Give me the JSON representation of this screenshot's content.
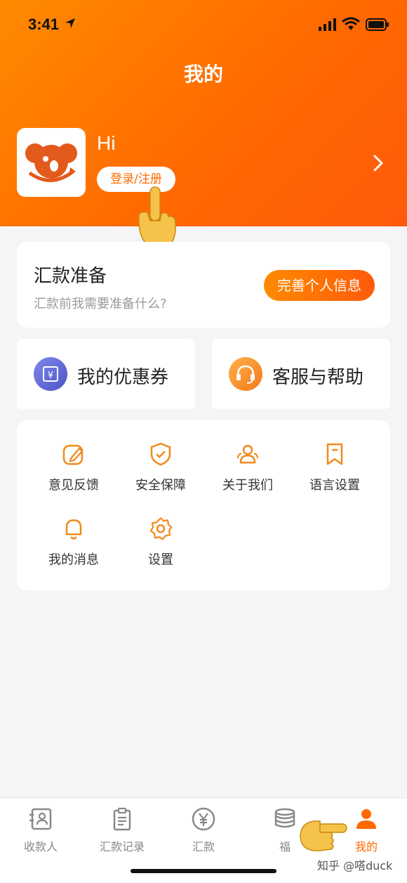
{
  "status_bar": {
    "time": "3:41"
  },
  "header": {
    "title": "我的"
  },
  "profile": {
    "greeting": "Hi",
    "login_label": "登录/注册"
  },
  "prep_card": {
    "title": "汇款准备",
    "subtitle": "汇款前我需要准备什么?",
    "button_label": "完善个人信息"
  },
  "quick_cards": [
    {
      "label": "我的优惠券",
      "icon": "coupon-icon"
    },
    {
      "label": "客服与帮助",
      "icon": "headset-icon"
    }
  ],
  "grid_items": [
    {
      "label": "意见反馈",
      "icon": "feedback-icon"
    },
    {
      "label": "安全保障",
      "icon": "shield-icon"
    },
    {
      "label": "关于我们",
      "icon": "people-icon"
    },
    {
      "label": "语言设置",
      "icon": "bookmark-icon"
    },
    {
      "label": "我的消息",
      "icon": "bell-icon"
    },
    {
      "label": "设置",
      "icon": "gear-icon"
    }
  ],
  "tabbar": {
    "items": [
      {
        "label": "收款人",
        "icon": "contact-card-icon"
      },
      {
        "label": "汇款记录",
        "icon": "clipboard-icon"
      },
      {
        "label": "汇款",
        "icon": "yen-coin-icon"
      },
      {
        "label": "福",
        "icon": "coin-stack-icon"
      },
      {
        "label": "我的",
        "icon": "person-icon"
      }
    ],
    "active_index": 4
  },
  "watermark": "知乎 @嗒duck",
  "colors": {
    "brand_orange": "#ff6a00",
    "accent_orange": "#ff8a00",
    "icon_orange": "#f08a1c",
    "coupon_blue": "#5b63d6"
  }
}
